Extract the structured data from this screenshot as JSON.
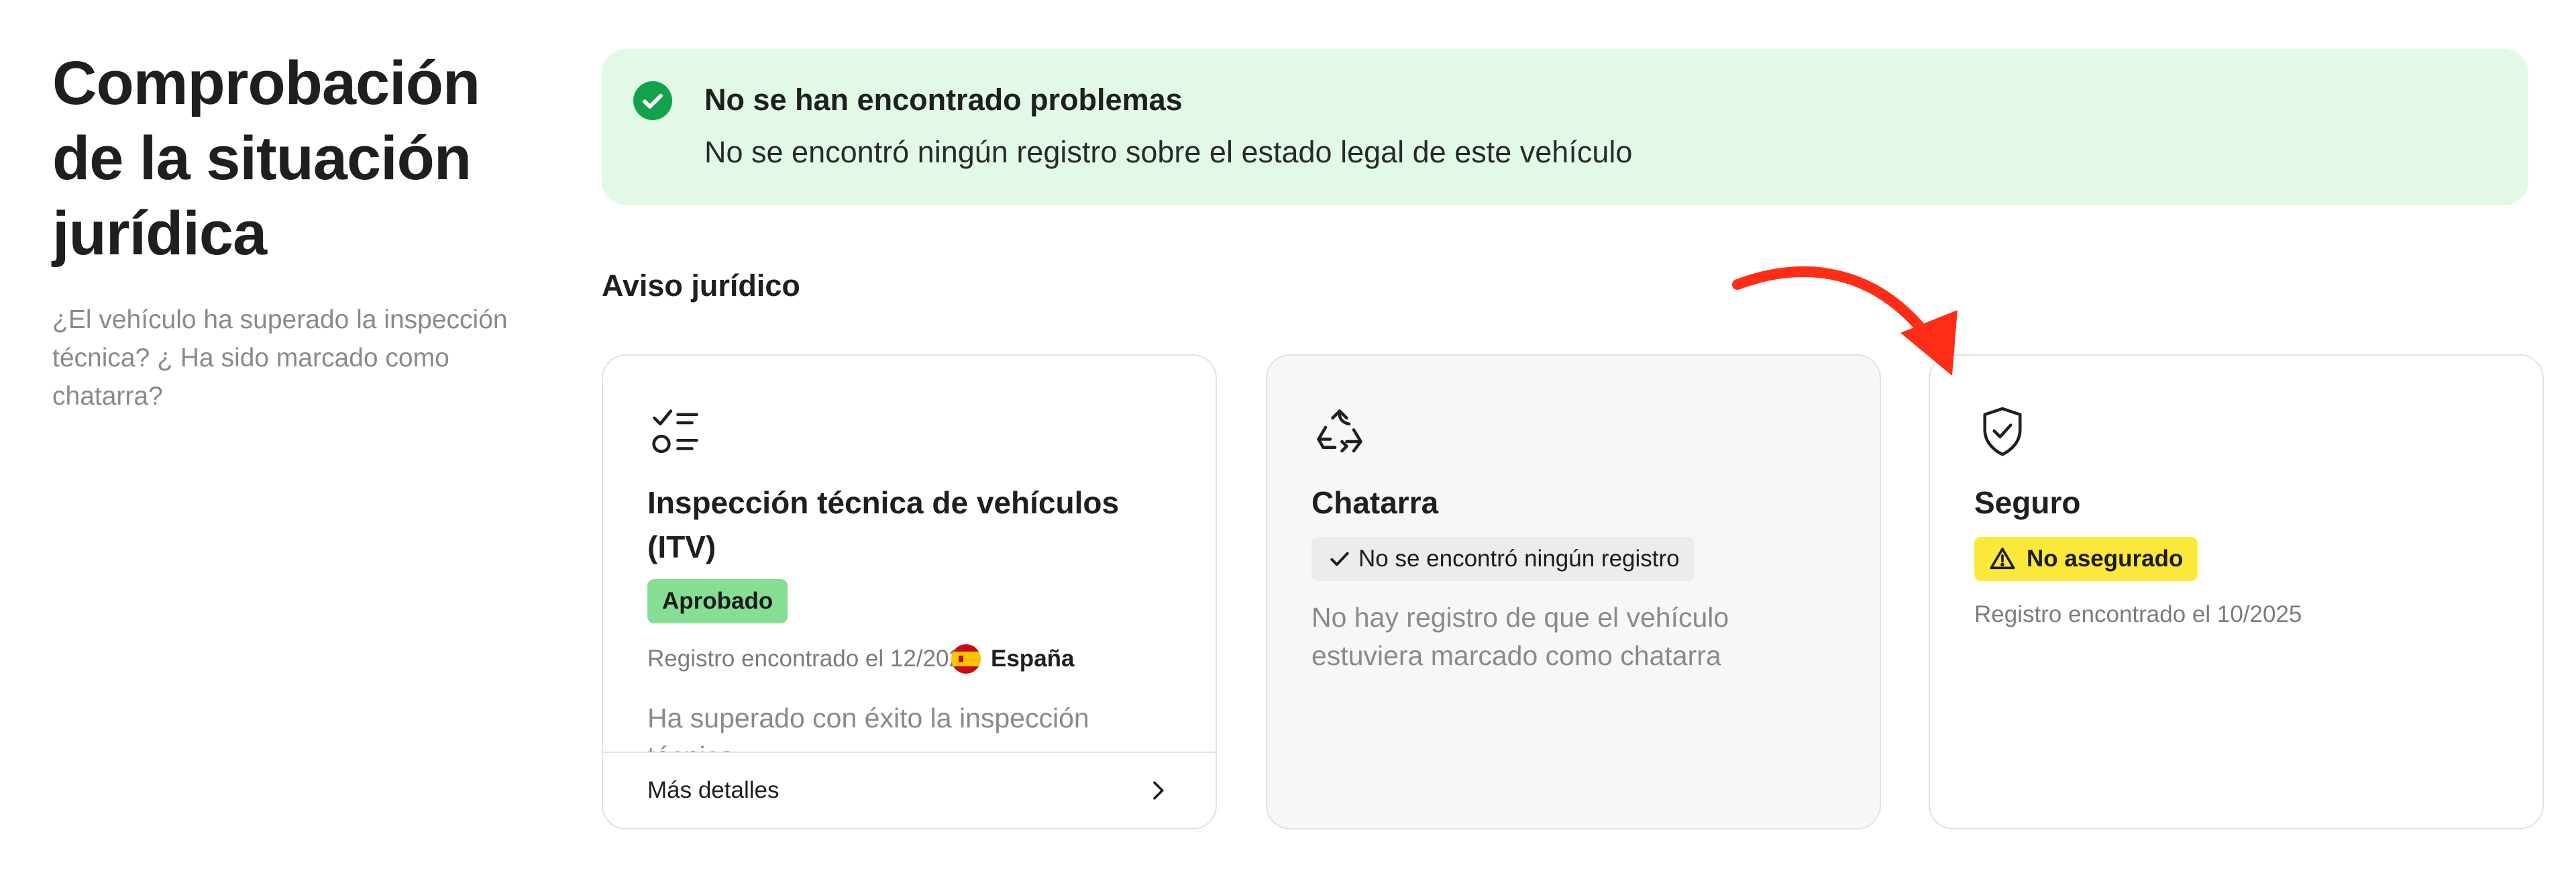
{
  "header": {
    "title": "Comprobación de la situación jurídica",
    "subtitle": "¿El vehículo ha superado la inspección técnica? ¿ Ha sido marcado como chatarra?"
  },
  "banner": {
    "icon": "check-circle-icon",
    "title": "No se han encontrado problemas",
    "text": "No se encontró ningún registro sobre el estado legal de este vehículo",
    "background": "#e3f9e7",
    "icon_color": "#13a24a"
  },
  "section": {
    "title": "Aviso jurídico"
  },
  "cards": {
    "itv": {
      "icon": "checklist-icon",
      "title": "Inspección técnica de vehículos (ITV)",
      "badge": "Aprobado",
      "badge_color": "#86de95",
      "record": "Registro encontrado el 12/2024",
      "country_flag": "spain-flag-icon",
      "country": "España",
      "description": "Ha superado con éxito la inspección técnica",
      "footer_link": "Más detalles"
    },
    "scrap": {
      "icon": "recycle-icon",
      "title": "Chatarra",
      "badge": "No se encontró ningún registro",
      "description": "No hay registro de que el vehículo estuviera marcado como chatarra"
    },
    "insurance": {
      "icon": "shield-check-icon",
      "title": "Seguro",
      "badge": "No asegurado",
      "badge_color": "#fce83a",
      "record": "Registro encontrado el 10/2025"
    }
  },
  "annotation": {
    "icon": "red-arrow-icon",
    "color": "#ff2d16"
  }
}
